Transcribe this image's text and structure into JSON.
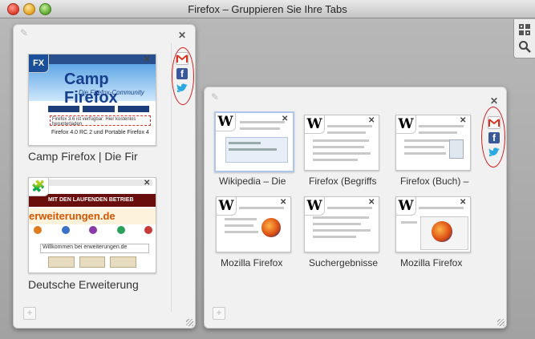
{
  "window": {
    "title": "Firefox – Gruppieren Sie Ihre Tabs"
  },
  "toolbar": {
    "tabview_icon": "tab-groups-icon",
    "search_icon": "search-icon"
  },
  "group_left": {
    "close_label": "✕",
    "tabs": [
      {
        "title": "Camp Firefox | Die Fir",
        "thumb": {
          "brand": "Camp Firefox",
          "subtitle": "Die Firefox-Community",
          "notice": "Firefox 3.6 ist verfügbar: Hier kostenlos herunterladen",
          "notice2": "Firefox 4.0 RC 2 und Portable Firefox 4"
        }
      },
      {
        "title": "Deutsche Erweiterung",
        "thumb": {
          "banner": "MIT DEN LAUFENDEN BETRIEB EINGESTELL",
          "name": "erweiterungen.de",
          "welcome": "Willkommen bei erweiterungen.de"
        }
      }
    ]
  },
  "group_right": {
    "close_label": "✕",
    "tabs": [
      {
        "title": "Wikipedia – Die"
      },
      {
        "title": "Firefox (Begriffs"
      },
      {
        "title": "Firefox (Buch) –"
      },
      {
        "title": "Mozilla Firefox"
      },
      {
        "title": "Suchergebnisse"
      },
      {
        "title": "Mozilla Firefox"
      }
    ]
  },
  "share_icons": [
    "gmail-icon",
    "facebook-icon",
    "twitter-icon"
  ],
  "colors": {
    "annotation": "#d01a1a",
    "facebook": "#3b5998",
    "twitter": "#2aa9e0"
  }
}
